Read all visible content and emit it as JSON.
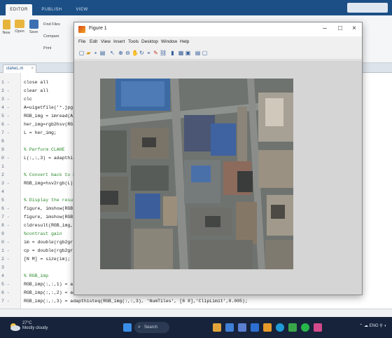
{
  "ribbon": {
    "tabs": [
      "EDITOR",
      "PUBLISH",
      "VIEW"
    ],
    "buttons": {
      "new": "New",
      "open": "Open",
      "save": "Save",
      "find_files": "Find Files",
      "compare": "Compare",
      "print": "Print"
    }
  },
  "editor": {
    "tab_label": "claheL.m",
    "lines": [
      {
        "n": "1 -",
        "text": "close all"
      },
      {
        "n": "2 -",
        "text": "clear all"
      },
      {
        "n": "3 -",
        "text": "clc"
      },
      {
        "n": "4 -",
        "text": "A=uigetfile('*.jpg"
      },
      {
        "n": "5 -",
        "text": "RGB_img = imread(A"
      },
      {
        "n": "6 -",
        "text": "her_img=rgb2hsv(RG"
      },
      {
        "n": "7 -",
        "text": "L = her_img;"
      },
      {
        "n": "8",
        "text": ""
      },
      {
        "n": "9",
        "text": "% Perform CLAHE"
      },
      {
        "n": "0 -",
        "text": "L(:,:,3) = adapthi"
      },
      {
        "n": "1",
        "text": ""
      },
      {
        "n": "2",
        "text": "% Convert back to R"
      },
      {
        "n": "3 -",
        "text": "RGB_img=hsv2rgb(L)"
      },
      {
        "n": "4",
        "text": ""
      },
      {
        "n": "5",
        "text": "% Display the resu"
      },
      {
        "n": "6 -",
        "text": "figure, imshow(RGB"
      },
      {
        "n": "7 -",
        "text": "figure, imshow(RGB"
      },
      {
        "n": "8 -",
        "text": "cldresult(RGB_img,"
      },
      {
        "n": "9",
        "text": "%contrast gain"
      },
      {
        "n": "0 -",
        "text": "im = double(rgb2gr"
      },
      {
        "n": "1 -",
        "text": "cp = double(rgb2gr"
      },
      {
        "n": "2 -",
        "text": "[N M] = size(im);"
      },
      {
        "n": "3",
        "text": ""
      },
      {
        "n": "4",
        "text": "% RGB_imp"
      },
      {
        "n": "5 -",
        "text": "RGB_imp(:,:,1) = a"
      },
      {
        "n": "6 -",
        "text": "RGB_imp(:,:,2) = adapthisteq(RGB_img(:,:,2), 'NumTiles', [8 8],'ClipLimit',0.005);"
      },
      {
        "n": "7 -",
        "text": "RGB_imp(:,:,3) = adapthisteq(RGB_img(:,:,3), 'NumTiles', [8 8],'ClipLimit',0.005);"
      }
    ]
  },
  "figure": {
    "title": "Figure 1",
    "menu": [
      "File",
      "Edit",
      "View",
      "Insert",
      "Tools",
      "Desktop",
      "Window",
      "Help"
    ],
    "controls": {
      "minimize": "–",
      "maximize": "□",
      "close": "×"
    }
  },
  "taskbar": {
    "weather_temp": "27°C",
    "weather_desc": "Mostly cloudy",
    "search": "Search",
    "tray": "ENG"
  },
  "colors": {
    "ribbon_bar": "#1b4f86",
    "taskbar": "#16233a",
    "comment": "#2c8a2c"
  }
}
